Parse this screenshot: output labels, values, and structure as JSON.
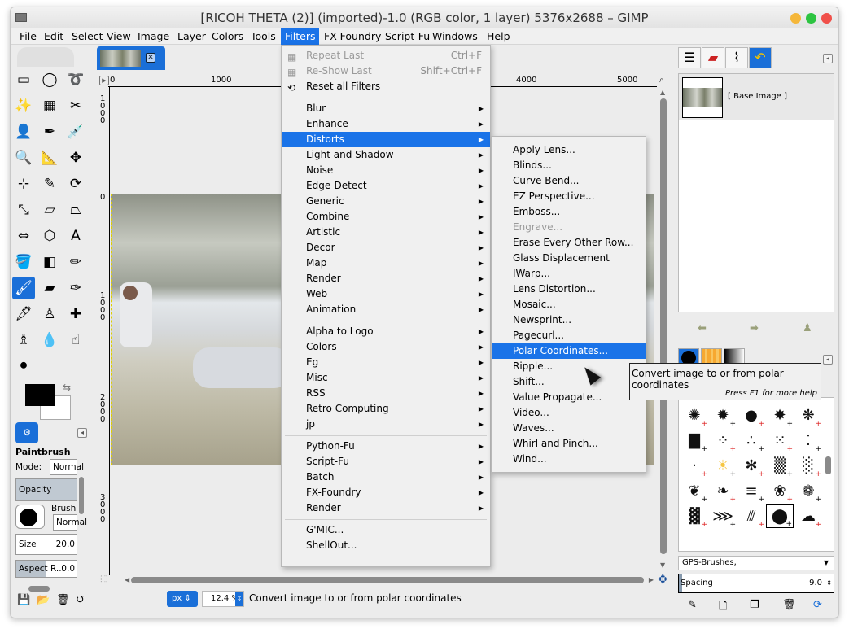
{
  "window": {
    "title": "[RICOH THETA (2)] (imported)-1.0 (RGB color, 1 layer) 5376x2688 – GIMP"
  },
  "menubar": [
    {
      "label": "File"
    },
    {
      "label": "Edit"
    },
    {
      "label": "Select"
    },
    {
      "label": "View"
    },
    {
      "label": "Image"
    },
    {
      "label": "Layer"
    },
    {
      "label": "Colors"
    },
    {
      "label": "Tools"
    },
    {
      "label": "Filters",
      "active": true
    },
    {
      "label": "FX-Foundry"
    },
    {
      "label": "Script-Fu"
    },
    {
      "label": "Windows"
    },
    {
      "label": "Help"
    }
  ],
  "toolbox": {
    "tools": [
      {
        "name": "rect-select-icon",
        "glyph": "▭"
      },
      {
        "name": "ellipse-select-icon",
        "glyph": "◯"
      },
      {
        "name": "free-select-icon",
        "glyph": "➰"
      },
      {
        "name": "fuzzy-select-icon",
        "glyph": "✨"
      },
      {
        "name": "select-by-color-icon",
        "glyph": "▦"
      },
      {
        "name": "scissors-icon",
        "glyph": "✂"
      },
      {
        "name": "foreground-select-icon",
        "glyph": "👤"
      },
      {
        "name": "paths-icon",
        "glyph": "✒"
      },
      {
        "name": "color-picker-icon",
        "glyph": "💉"
      },
      {
        "name": "zoom-icon",
        "glyph": "🔍"
      },
      {
        "name": "measure-icon",
        "glyph": "📐"
      },
      {
        "name": "move-icon",
        "glyph": "✥"
      },
      {
        "name": "align-icon",
        "glyph": "⊹"
      },
      {
        "name": "crop-icon",
        "glyph": "✎"
      },
      {
        "name": "rotate-icon",
        "glyph": "⟳"
      },
      {
        "name": "scale-icon",
        "glyph": "⤡"
      },
      {
        "name": "shear-icon",
        "glyph": "▱"
      },
      {
        "name": "perspective-icon",
        "glyph": "⏢"
      },
      {
        "name": "flip-icon",
        "glyph": "⇔"
      },
      {
        "name": "cage-icon",
        "glyph": "⬡"
      },
      {
        "name": "text-icon",
        "glyph": "A"
      },
      {
        "name": "bucket-fill-icon",
        "glyph": "🪣"
      },
      {
        "name": "blend-icon",
        "glyph": "◧"
      },
      {
        "name": "pencil-icon",
        "glyph": "✏"
      },
      {
        "name": "paintbrush-icon",
        "glyph": "🖌",
        "selected": true
      },
      {
        "name": "eraser-icon",
        "glyph": "▰"
      },
      {
        "name": "airbrush-icon",
        "glyph": "✑"
      },
      {
        "name": "ink-icon",
        "glyph": "🖋"
      },
      {
        "name": "clone-icon",
        "glyph": "♙"
      },
      {
        "name": "heal-icon",
        "glyph": "✚"
      },
      {
        "name": "perspective-clone-icon",
        "glyph": "♗"
      },
      {
        "name": "blur-sharpen-icon",
        "glyph": "💧"
      },
      {
        "name": "smudge-icon",
        "glyph": "☝"
      },
      {
        "name": "dodge-burn-icon",
        "glyph": "⚫"
      }
    ]
  },
  "tool_options": {
    "title": "Paintbrush",
    "mode_label": "Mode:",
    "mode_value": "Normal",
    "opacity_label": "Opacity",
    "brush_label": "Brush",
    "brush_value": "Normal",
    "size_label": "Size",
    "size_value": "20.0",
    "aspect_label": "Aspect R...",
    "aspect_value": "0.0"
  },
  "image_window": {
    "hruler_labels": [
      "0",
      "1000",
      "4000",
      "5000"
    ],
    "vruler_labels": [
      "1000",
      "0",
      "1000",
      "2000",
      "3000"
    ],
    "unit": "px",
    "zoom": "12.4 %",
    "status_message": "Convert image to or from polar coordinates"
  },
  "filters_menu": {
    "items": [
      {
        "label": "Repeat Last",
        "accel": "Ctrl+F",
        "disabled": true,
        "icon": "repeat-icon"
      },
      {
        "label": "Re-Show Last",
        "accel": "Shift+Ctrl+F",
        "disabled": true,
        "icon": "reshow-icon"
      },
      {
        "label": "Reset all Filters",
        "icon": "reset-icon"
      },
      {
        "sep": true
      },
      {
        "label": "Blur",
        "sub": true
      },
      {
        "label": "Enhance",
        "sub": true
      },
      {
        "label": "Distorts",
        "sub": true,
        "highlighted": true
      },
      {
        "label": "Light and Shadow",
        "sub": true
      },
      {
        "label": "Noise",
        "sub": true
      },
      {
        "label": "Edge-Detect",
        "sub": true
      },
      {
        "label": "Generic",
        "sub": true
      },
      {
        "label": "Combine",
        "sub": true
      },
      {
        "label": "Artistic",
        "sub": true
      },
      {
        "label": "Decor",
        "sub": true
      },
      {
        "label": "Map",
        "sub": true
      },
      {
        "label": "Render",
        "sub": true
      },
      {
        "label": "Web",
        "sub": true
      },
      {
        "label": "Animation",
        "sub": true
      },
      {
        "sep": true
      },
      {
        "label": "Alpha to Logo",
        "sub": true
      },
      {
        "label": "Colors",
        "sub": true
      },
      {
        "label": "Eg",
        "sub": true
      },
      {
        "label": "Misc",
        "sub": true
      },
      {
        "label": "RSS",
        "sub": true
      },
      {
        "label": "Retro Computing",
        "sub": true
      },
      {
        "label": "jp",
        "sub": true
      },
      {
        "sep": true
      },
      {
        "label": "Python-Fu",
        "sub": true
      },
      {
        "label": "Script-Fu",
        "sub": true
      },
      {
        "label": "Batch",
        "sub": true
      },
      {
        "label": "FX-Foundry",
        "sub": true
      },
      {
        "label": "Render",
        "sub": true
      },
      {
        "sep": true
      },
      {
        "label": "G'MIC..."
      },
      {
        "label": "ShellOut..."
      }
    ]
  },
  "distorts_menu": {
    "items": [
      {
        "label": "Apply Lens..."
      },
      {
        "label": "Blinds..."
      },
      {
        "label": "Curve Bend..."
      },
      {
        "label": "EZ Perspective..."
      },
      {
        "label": "Emboss..."
      },
      {
        "label": "Engrave...",
        "disabled": true
      },
      {
        "label": "Erase Every Other Row..."
      },
      {
        "label": "Glass Displacement"
      },
      {
        "label": "IWarp..."
      },
      {
        "label": "Lens Distortion..."
      },
      {
        "label": "Mosaic..."
      },
      {
        "label": "Newsprint..."
      },
      {
        "label": "Pagecurl..."
      },
      {
        "label": "Polar Coordinates...",
        "highlighted": true
      },
      {
        "label": "Ripple..."
      },
      {
        "label": "Shift..."
      },
      {
        "label": "Value Propagate..."
      },
      {
        "label": "Video..."
      },
      {
        "label": "Waves..."
      },
      {
        "label": "Whirl and Pinch..."
      },
      {
        "label": "Wind..."
      }
    ]
  },
  "tooltip": {
    "text": "Convert image to or from polar coordinates",
    "hint": "Press F1 for more help"
  },
  "layers_dock": {
    "tabs": [
      "layers-tab",
      "channels-tab",
      "paths-tab",
      "undo-history-tab"
    ],
    "layer_name": "[ Base Image ]"
  },
  "brushes_dock": {
    "collection": "GPS-Brushes,",
    "spacing_label": "Spacing",
    "spacing_value": "9.0"
  }
}
